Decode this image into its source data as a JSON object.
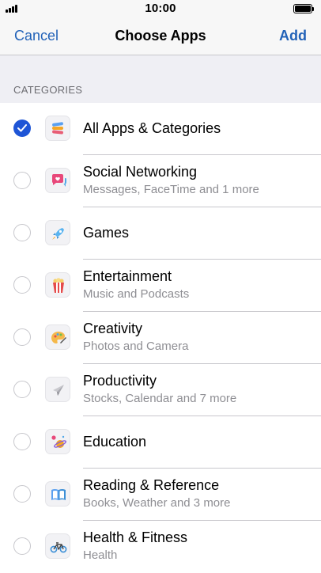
{
  "status_bar": {
    "time": "10:00",
    "signal_icon": "signal-bars-icon",
    "battery_icon": "battery-full-icon"
  },
  "nav": {
    "cancel_label": "Cancel",
    "title": "Choose Apps",
    "add_label": "Add",
    "accent_color": "#2262b8"
  },
  "section": {
    "header": "CATEGORIES"
  },
  "categories": [
    {
      "title": "All Apps & Categories",
      "subtitle": "",
      "selected": true,
      "icon": "stack-icon"
    },
    {
      "title": "Social Networking",
      "subtitle": "Messages, FaceTime and 1 more",
      "selected": false,
      "icon": "chat-bubble-heart-icon"
    },
    {
      "title": "Games",
      "subtitle": "",
      "selected": false,
      "icon": "rocket-icon"
    },
    {
      "title": "Entertainment",
      "subtitle": "Music and Podcasts",
      "selected": false,
      "icon": "popcorn-icon"
    },
    {
      "title": "Creativity",
      "subtitle": "Photos and Camera",
      "selected": false,
      "icon": "palette-icon"
    },
    {
      "title": "Productivity",
      "subtitle": "Stocks, Calendar and 7 more",
      "selected": false,
      "icon": "paper-plane-icon"
    },
    {
      "title": "Education",
      "subtitle": "",
      "selected": false,
      "icon": "planet-icon"
    },
    {
      "title": "Reading & Reference",
      "subtitle": "Books, Weather and 3 more",
      "selected": false,
      "icon": "open-book-icon"
    },
    {
      "title": "Health & Fitness",
      "subtitle": "Health",
      "selected": false,
      "icon": "bicycle-icon"
    }
  ]
}
